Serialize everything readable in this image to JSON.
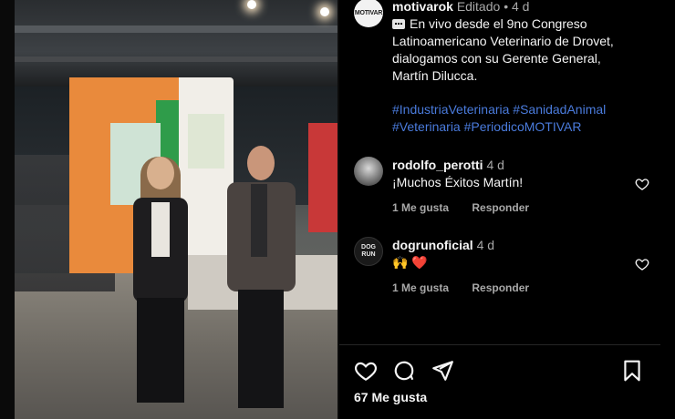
{
  "post": {
    "author": "motivarok",
    "author_avatar_text": "MOTIVAR",
    "edited_label": "Editado",
    "separator": "•",
    "time": "4 d",
    "caption": "En vivo desde el 9no Congreso Latinoamericano Veterinario de Drovet, dialogamos con su Gerente General, Martín Dilucca.",
    "hashtags": "#IndustriaVeterinaria #SanidadAnimal #Veterinaria #PeriodicoMOTIVAR",
    "likes": "67 Me gusta"
  },
  "comments": [
    {
      "user": "rodolfo_perotti",
      "time": "4 d",
      "text": "¡Muchos Éxitos Martín!",
      "likes_label": "1 Me gusta",
      "reply_label": "Responder"
    },
    {
      "user": "dogrunoficial",
      "time": "4 d",
      "text": "🙌 ❤️",
      "avatar_text": "DOG RUN",
      "likes_label": "1 Me gusta",
      "reply_label": "Responder"
    }
  ],
  "colors": {
    "background": "#000000",
    "hashtag": "#4a7bdc",
    "muted": "#a8a8a8"
  },
  "icons": [
    "heart-icon",
    "comment-icon",
    "share-icon",
    "bookmark-icon",
    "message-icon"
  ]
}
